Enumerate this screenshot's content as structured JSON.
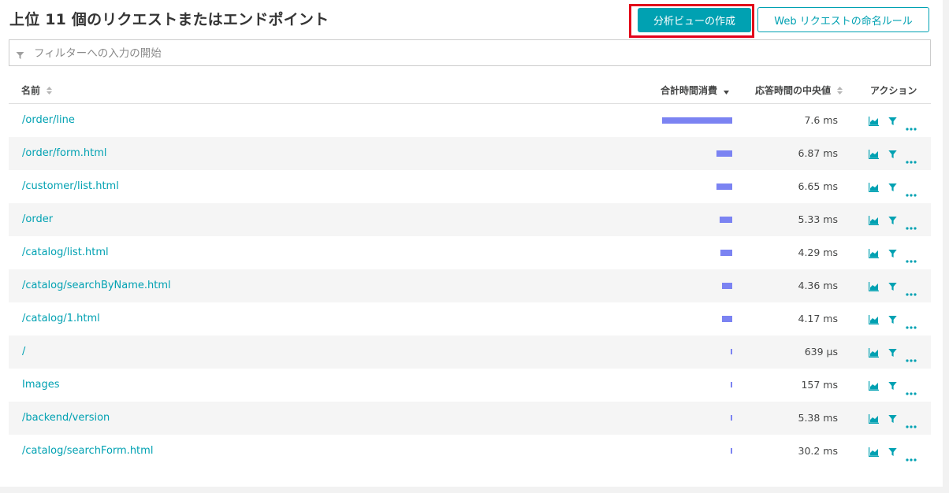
{
  "header": {
    "title": "上位 11 個のリクエストまたはエンドポイント",
    "primary_button": "分析ビューの作成",
    "secondary_button": "Web リクエストの命名ルール"
  },
  "filter": {
    "placeholder": "フィルターへの入力の開始"
  },
  "table": {
    "columns": {
      "name": "名前",
      "total_time": "合計時間消費",
      "median": "応答時間の中央値",
      "actions": "アクション"
    },
    "rows": [
      {
        "name": "/order/line",
        "total_time_share": 1.0,
        "median": "7.6 ms"
      },
      {
        "name": "/order/form.html",
        "total_time_share": 0.22,
        "median": "6.87 ms"
      },
      {
        "name": "/customer/list.html",
        "total_time_share": 0.22,
        "median": "6.65 ms"
      },
      {
        "name": "/order",
        "total_time_share": 0.18,
        "median": "5.33 ms"
      },
      {
        "name": "/catalog/list.html",
        "total_time_share": 0.17,
        "median": "4.29 ms"
      },
      {
        "name": "/catalog/searchByName.html",
        "total_time_share": 0.15,
        "median": "4.36 ms"
      },
      {
        "name": "/catalog/1.html",
        "total_time_share": 0.15,
        "median": "4.17 ms"
      },
      {
        "name": "/",
        "total_time_share": 0.02,
        "median": "639 μs"
      },
      {
        "name": "Images",
        "total_time_share": 0.01,
        "median": "157 ms"
      },
      {
        "name": "/backend/version",
        "total_time_share": 0.01,
        "median": "5.38 ms"
      },
      {
        "name": "/catalog/searchForm.html",
        "total_time_share": 0.01,
        "median": "30.2 ms"
      }
    ]
  },
  "colors": {
    "accent": "#00a1b2",
    "bar": "#7b83f2",
    "highlight": "#e2001a"
  },
  "icons": {
    "filter": "funnel-icon",
    "chart": "chart-icon",
    "more": "more-icon",
    "sort": "sort-icon"
  }
}
